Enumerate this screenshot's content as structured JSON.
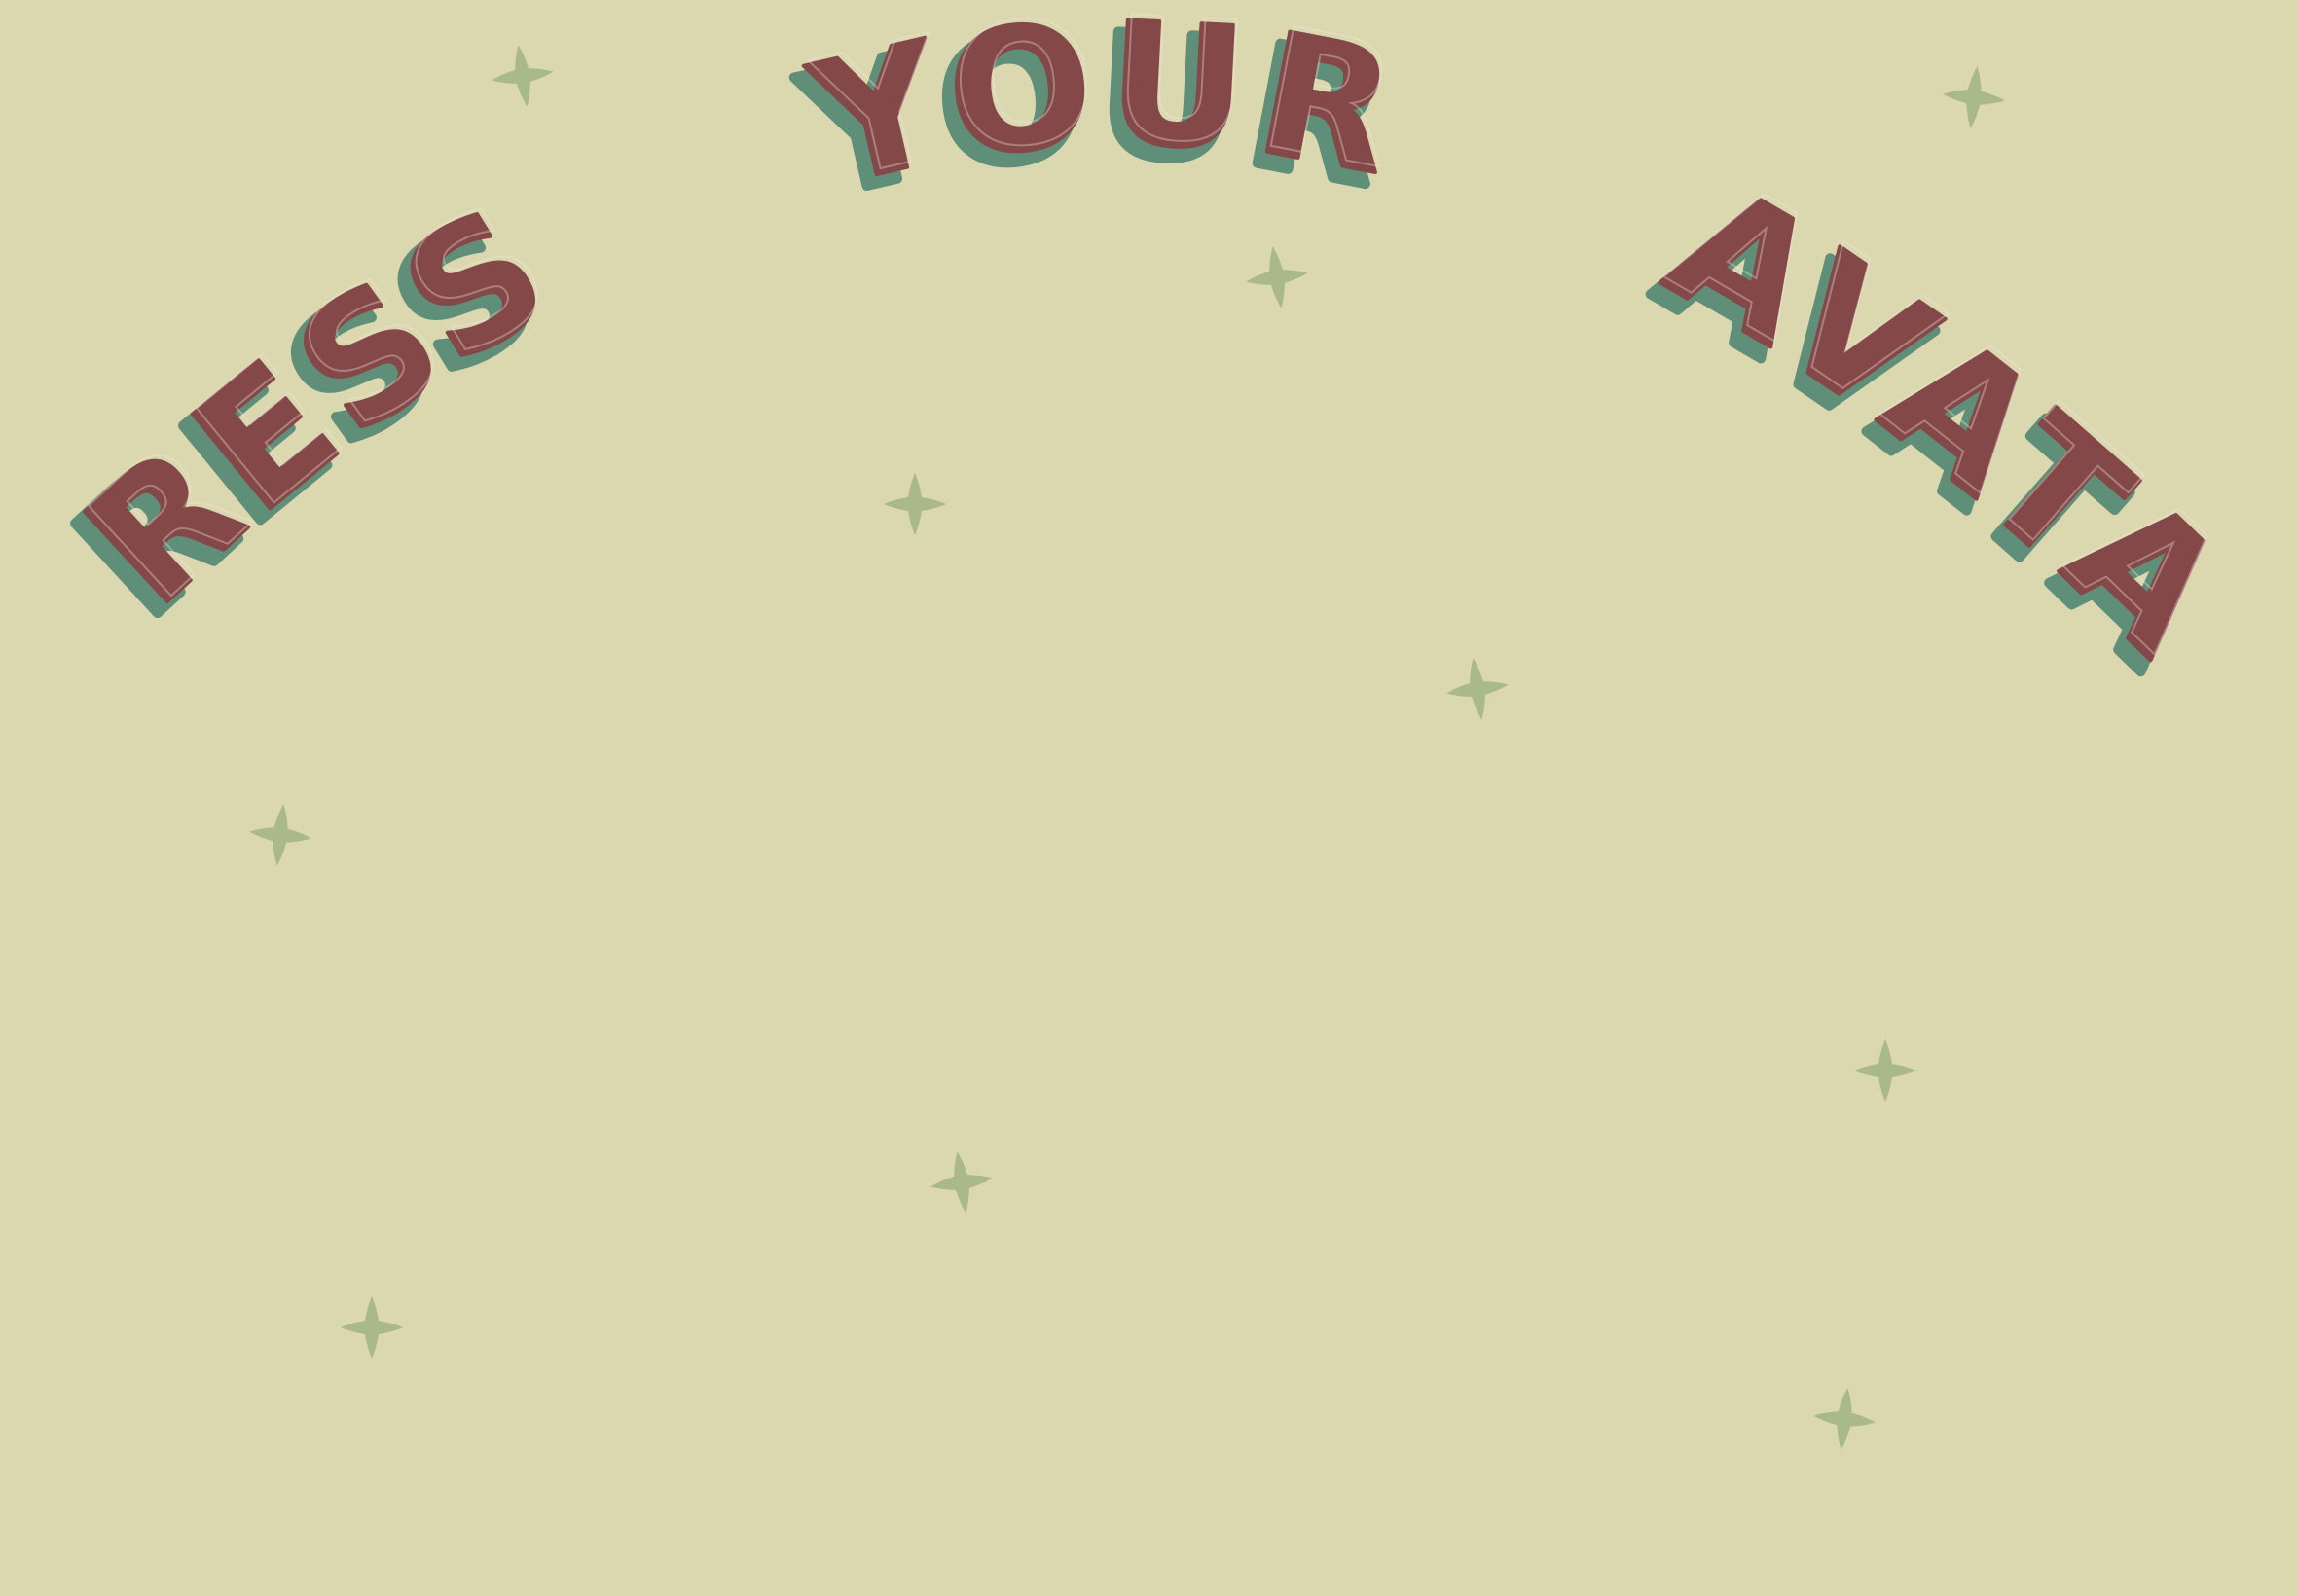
{
  "screen": {
    "title_words": [
      "DRESS",
      "YOUR",
      "AVATAR"
    ],
    "colors": {
      "background": "#dbd7ae",
      "title_fill": "#844848",
      "title_shadow": "#5f8f79",
      "title_highlight": "#f4e7e1",
      "sparkle": "#a9b989"
    },
    "decorations": {
      "icon": "sparkle-icon",
      "count": 12
    }
  }
}
